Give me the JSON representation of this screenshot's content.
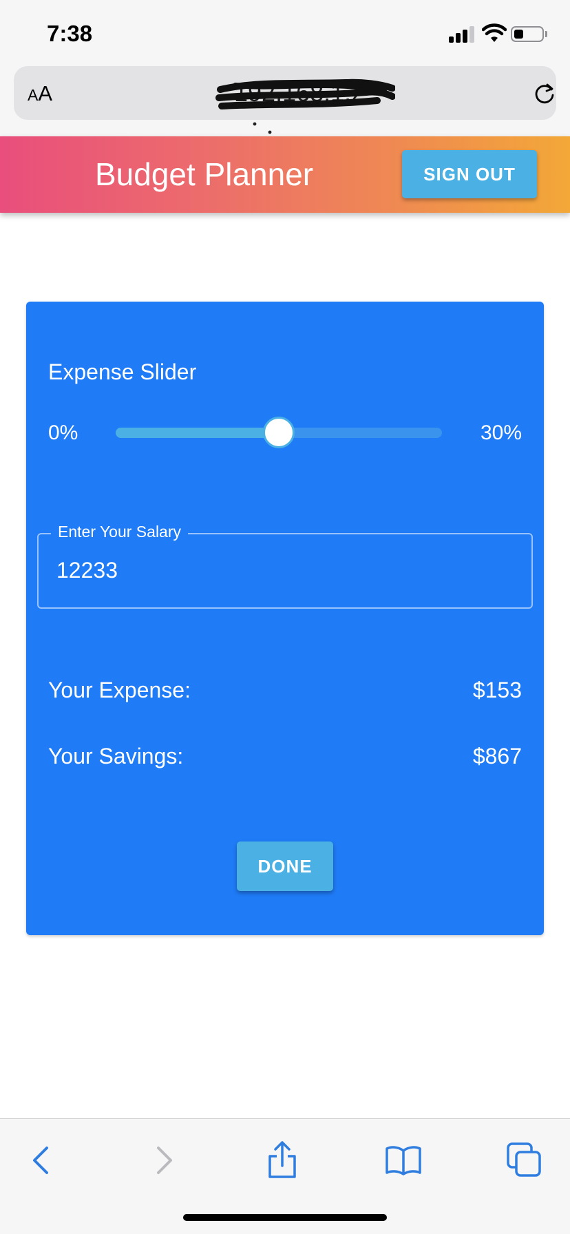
{
  "status_bar": {
    "time": "7:38",
    "icons": [
      "cellular-signal-icon",
      "wifi-icon",
      "battery-icon"
    ]
  },
  "browser": {
    "aa_small": "A",
    "aa_large": "A",
    "url": "192.168.1.2",
    "reload_icon": "reload-icon"
  },
  "header": {
    "title": "Budget Planner",
    "sign_out_label": "SIGN OUT",
    "gradient_start": "#e94e7c",
    "gradient_end": "#f3a838"
  },
  "card": {
    "background": "#1f7bf6",
    "slider": {
      "label": "Expense Slider",
      "min_label": "0%",
      "max_label": "30%",
      "value_fraction": 0.5
    },
    "salary": {
      "legend": "Enter Your Salary",
      "value": "12233"
    },
    "expense": {
      "label": "Your Expense:",
      "value": "$153"
    },
    "savings": {
      "label": "Your Savings:",
      "value": "$867"
    },
    "done_label": "DONE"
  },
  "toolbar": {
    "icons": [
      "back-icon",
      "forward-icon",
      "share-icon",
      "bookmarks-icon",
      "tabs-icon"
    ],
    "accent": "#2f7ddf"
  }
}
